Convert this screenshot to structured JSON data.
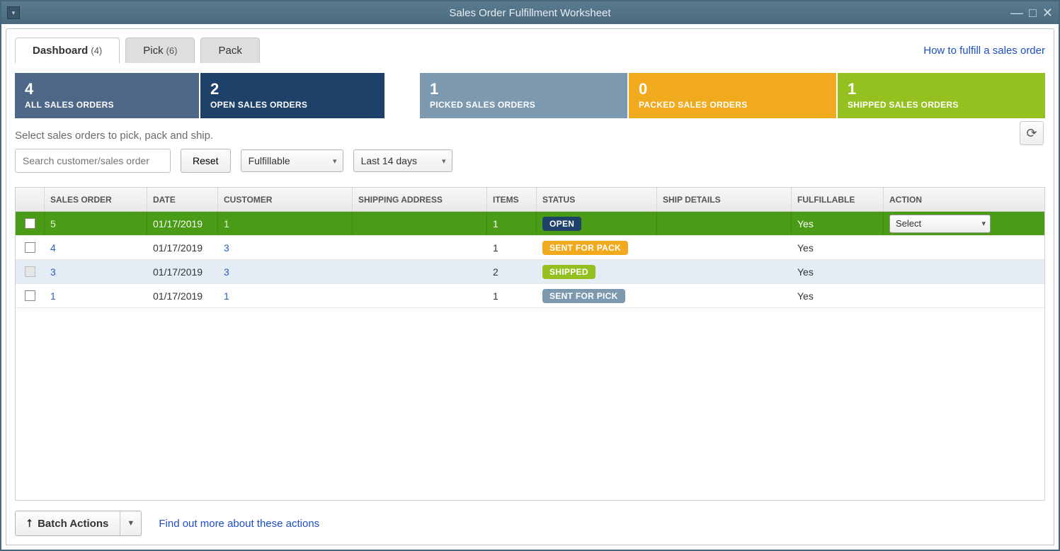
{
  "window": {
    "title": "Sales Order Fulfillment Worksheet"
  },
  "tabs": [
    {
      "label": "Dashboard",
      "count": "(4)",
      "active": true
    },
    {
      "label": "Pick",
      "count": "(6)",
      "active": false
    },
    {
      "label": "Pack",
      "count": "",
      "active": false
    }
  ],
  "help_link": "How to fulfill a sales order",
  "cards": {
    "all": {
      "num": "4",
      "label": "ALL SALES ORDERS"
    },
    "open": {
      "num": "2",
      "label": "OPEN SALES ORDERS"
    },
    "picked": {
      "num": "1",
      "label": "PICKED SALES ORDERS"
    },
    "packed": {
      "num": "0",
      "label": "PACKED SALES ORDERS"
    },
    "shipped": {
      "num": "1",
      "label": "SHIPPED SALES ORDERS"
    }
  },
  "instructions": "Select sales orders to pick, pack and ship.",
  "filters": {
    "search_placeholder": "Search customer/sales order",
    "reset_label": "Reset",
    "fulfillable_value": "Fulfillable",
    "date_range_value": "Last 14 days"
  },
  "table": {
    "headers": {
      "sales_order": "SALES ORDER",
      "date": "DATE",
      "customer": "CUSTOMER",
      "shipping_address": "SHIPPING ADDRESS",
      "items": "ITEMS",
      "status": "STATUS",
      "ship_details": "SHIP DETAILS",
      "fulfillable": "FULFILLABLE",
      "action": "ACTION"
    },
    "rows": [
      {
        "selected": true,
        "disabled": false,
        "sales_order": "5",
        "date": "01/17/2019",
        "customer": "1",
        "shipping_address": "",
        "items": "1",
        "status": "OPEN",
        "status_class": "status-open",
        "ship_details": "",
        "fulfillable": "Yes",
        "action": "Select"
      },
      {
        "selected": false,
        "disabled": false,
        "sales_order": "4",
        "date": "01/17/2019",
        "customer": "3",
        "shipping_address": "",
        "items": "1",
        "status": "SENT FOR PACK",
        "status_class": "status-sentpack",
        "ship_details": "",
        "fulfillable": "Yes",
        "action": ""
      },
      {
        "selected": false,
        "disabled": true,
        "sales_order": "3",
        "date": "01/17/2019",
        "customer": "3",
        "shipping_address": "",
        "items": "2",
        "status": "SHIPPED",
        "status_class": "status-shipped",
        "ship_details": "",
        "fulfillable": "Yes",
        "action": ""
      },
      {
        "selected": false,
        "disabled": false,
        "sales_order": "1",
        "date": "01/17/2019",
        "customer": "1",
        "shipping_address": "",
        "items": "1",
        "status": "SENT FOR PICK",
        "status_class": "status-sentpick",
        "ship_details": "",
        "fulfillable": "Yes",
        "action": ""
      }
    ]
  },
  "footer": {
    "batch_label": "Batch Actions",
    "info_link": "Find out more about these actions"
  }
}
